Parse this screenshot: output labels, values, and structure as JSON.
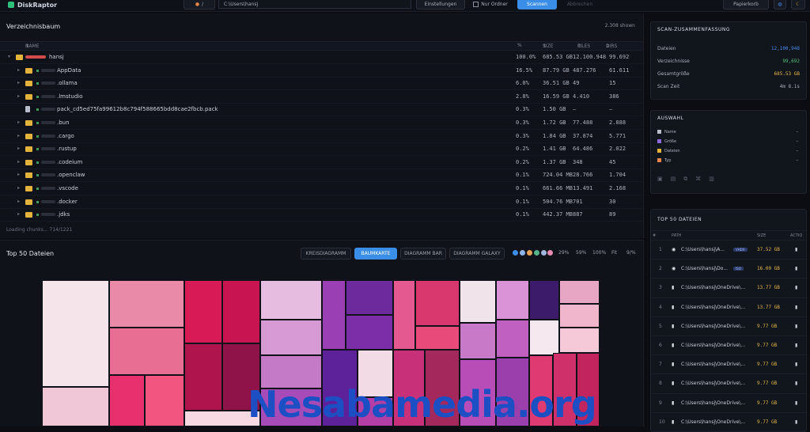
{
  "app": {
    "title": "DiskRaptor"
  },
  "toolbar": {
    "path_value": "C:\\Users\\hansj",
    "btn_pre": "Einstellungen",
    "checkbox_label": "Nur Ordner",
    "scan_label": "Scannen",
    "stop_label": "Abbrechen",
    "papierkorb_label": "Papierkorb",
    "dropdown_label": "/"
  },
  "tree": {
    "title": "Verzeichnisbaum",
    "count": "2.308 shown",
    "headers": {
      "name": "NAME",
      "pct": "%",
      "size": "SIZE",
      "files": "FILES",
      "dirs": "DIRS"
    },
    "rows": [
      {
        "name": "hansj",
        "pct": "100.0%",
        "size": "685.53 GB",
        "files": "12.100.948",
        "dirs": "99.692",
        "type": "folder",
        "expanded": true
      },
      {
        "name": "AppData",
        "pct": "16.5%",
        "size": "87.79 GB",
        "files": "487.276",
        "dirs": "61.611",
        "type": "folder"
      },
      {
        "name": ".ollama",
        "pct": "6.0%",
        "size": "36.51 GB",
        "files": "49",
        "dirs": "15",
        "type": "folder"
      },
      {
        "name": ".lmstudio",
        "pct": "2.8%",
        "size": "16.59 GB",
        "files": "4.410",
        "dirs": "386",
        "type": "folder"
      },
      {
        "name": "pack_cd5ed75fa99612b8c794f588665bdd8cae2fbcb.pack",
        "pct": "0.3%",
        "size": "1.50 GB",
        "files": "–",
        "dirs": "–",
        "type": "file"
      },
      {
        "name": ".bun",
        "pct": "0.3%",
        "size": "1.72 GB",
        "files": "77.488",
        "dirs": "2.888",
        "type": "folder"
      },
      {
        "name": ".cargo",
        "pct": "0.3%",
        "size": "1.84 GB",
        "files": "37.874",
        "dirs": "5.771",
        "type": "folder"
      },
      {
        "name": ".rustup",
        "pct": "0.2%",
        "size": "1.41 GB",
        "files": "64.486",
        "dirs": "2.022",
        "type": "folder"
      },
      {
        "name": ".codeium",
        "pct": "0.2%",
        "size": "1.37 GB",
        "files": "348",
        "dirs": "45",
        "type": "folder"
      },
      {
        "name": ".openclaw",
        "pct": "0.1%",
        "size": "724.04 MB",
        "files": "28.766",
        "dirs": "1.704",
        "type": "folder"
      },
      {
        "name": ".vscode",
        "pct": "0.1%",
        "size": "661.66 MB",
        "files": "13.491",
        "dirs": "2.168",
        "type": "folder"
      },
      {
        "name": ".docker",
        "pct": "0.1%",
        "size": "504.76 MB",
        "files": "701",
        "dirs": "30",
        "type": "folder"
      },
      {
        "name": ".jdks",
        "pct": "0.1%",
        "size": "442.37 MB",
        "files": "887",
        "dirs": "89",
        "type": "folder"
      }
    ],
    "loading": "Loading chunks... 714/1221"
  },
  "top_files_view": {
    "title": "Top 50 Dateien",
    "tabs": [
      "KREISDIAGRAMM",
      "BAUMKARTE",
      "DIAGRAMM BAR",
      "DIAGRAMM GALAXY"
    ],
    "active_tab": 1,
    "swatches": [
      "#3b8ee8",
      "#8fb4e8",
      "#e4a259",
      "#57b38a",
      "#9fb7d8",
      "#e88ab0"
    ],
    "pct_options": [
      "29%",
      "59%",
      "100%",
      "Fit"
    ],
    "page_label": "9/%"
  },
  "watermark": "Nesabamedia.org",
  "summary": {
    "title": "SCAN-ZUSAMMENFASSUNG",
    "items": [
      {
        "k": "Dateien",
        "v": "12,100,948",
        "color": "#4a8df0"
      },
      {
        "k": "Verzeichnisse",
        "v": "99,692",
        "color": "#4ec27a"
      },
      {
        "k": "Gesamtgröße",
        "v": "685.53 GB",
        "color": "#e5b54a"
      },
      {
        "k": "Scan Zeit",
        "v": "4m 8.1s",
        "color": "#aab0bb"
      }
    ]
  },
  "selection": {
    "title": "AUSWAHL",
    "rows": [
      {
        "k": "Name",
        "v": "–"
      },
      {
        "k": "Größe",
        "v": "–"
      },
      {
        "k": "Dateien",
        "v": "–"
      },
      {
        "k": "Typ",
        "v": "–"
      }
    ]
  },
  "top50": {
    "title": "TOP 50 DATEIEN",
    "headers": {
      "idx": "#",
      "path": "PATH",
      "size": "SIZE",
      "action": "ACTIO"
    },
    "rows": [
      {
        "i": "1",
        "path": "C:\\Users\\hansj\\A...",
        "badge": "VHDX",
        "size": "37.52 GB"
      },
      {
        "i": "2",
        "path": "C:\\Users\\hansj\\Do...",
        "badge": "ISO",
        "size": "16.00 GB"
      },
      {
        "i": "3",
        "path": "C:\\Users\\hansj\\OneDrive\\...",
        "badge": "",
        "size": "13.77 GB"
      },
      {
        "i": "4",
        "path": "C:\\Users\\hansj\\OneDrive\\...",
        "badge": "",
        "size": "13.77 GB"
      },
      {
        "i": "5",
        "path": "C:\\Users\\hansj\\OneDrive\\...",
        "badge": "",
        "size": "9.77 GB"
      },
      {
        "i": "6",
        "path": "C:\\Users\\hansj\\OneDrive\\...",
        "badge": "",
        "size": "9.77 GB"
      },
      {
        "i": "7",
        "path": "C:\\Users\\hansj\\OneDrive\\...",
        "badge": "",
        "size": "9.77 GB"
      },
      {
        "i": "8",
        "path": "C:\\Users\\hansj\\OneDrive\\...",
        "badge": "",
        "size": "9.77 GB"
      },
      {
        "i": "9",
        "path": "C:\\Users\\hansj\\OneDrive\\...",
        "badge": "",
        "size": "9.77 GB"
      },
      {
        "i": "10",
        "path": "C:\\Users\\hansj\\OneDrive\\...",
        "badge": "",
        "size": "9.77 GB"
      }
    ]
  }
}
